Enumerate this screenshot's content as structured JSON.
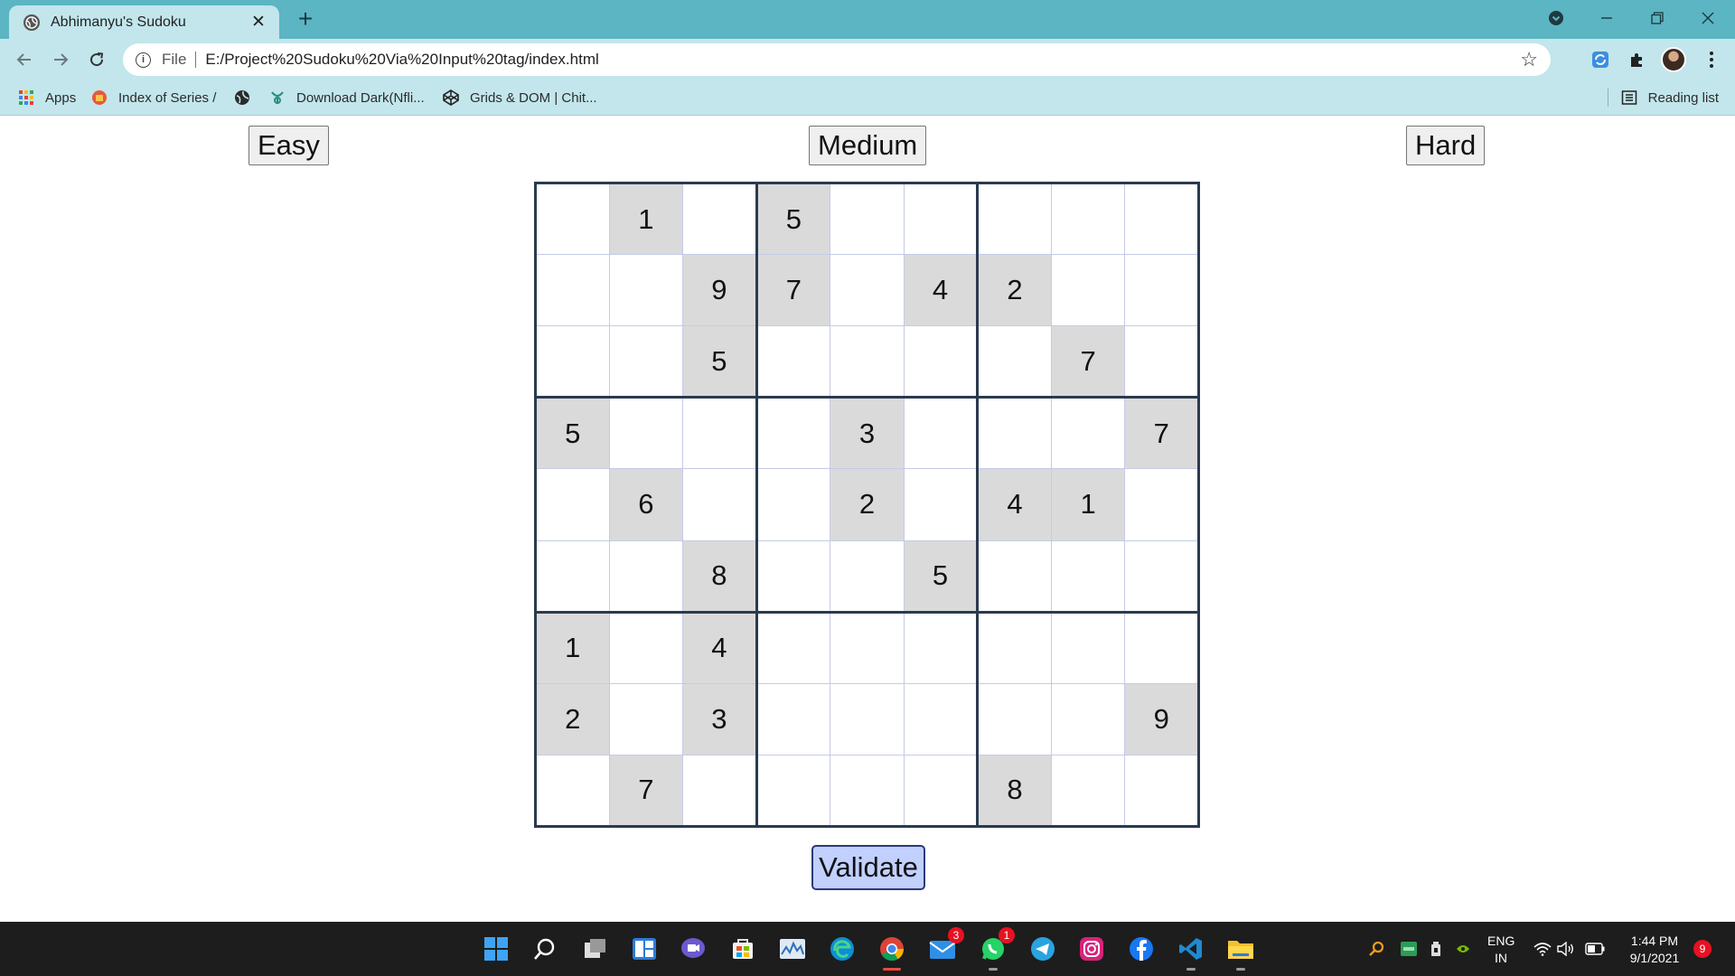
{
  "browser": {
    "tab_title": "Abhimanyu's Sudoku",
    "tab_close": "✕",
    "new_tab": "+",
    "address": {
      "scheme_label": "File",
      "url": "E:/Project%20Sudoku%20Via%20Input%20tag/index.html"
    },
    "bookmarks": [
      {
        "label": "Apps",
        "icon": "apps-grid-icon"
      },
      {
        "label": "Index of Series /",
        "icon": "index-favicon"
      },
      {
        "label": "",
        "icon": "globe-icon"
      },
      {
        "label": "Download Dark(Nfli...",
        "icon": "download-favicon"
      },
      {
        "label": "Grids & DOM | Chit...",
        "icon": "codepen-icon"
      }
    ],
    "reading_list": "Reading list"
  },
  "page": {
    "difficulty": {
      "easy": "Easy",
      "medium": "Medium",
      "hard": "Hard"
    },
    "validate_label": "Validate",
    "grid": [
      [
        "",
        "1",
        "",
        "5",
        "",
        "",
        "",
        "",
        ""
      ],
      [
        "",
        "",
        "9",
        "7",
        "",
        "4",
        "2",
        "",
        ""
      ],
      [
        "",
        "",
        "5",
        "",
        "",
        "",
        "",
        "7",
        ""
      ],
      [
        "5",
        "",
        "",
        "",
        "3",
        "",
        "",
        "",
        "7"
      ],
      [
        "",
        "6",
        "",
        "",
        "2",
        "",
        "4",
        "1",
        ""
      ],
      [
        "",
        "",
        "8",
        "",
        "",
        "5",
        "",
        "",
        ""
      ],
      [
        "1",
        "",
        "4",
        "",
        "",
        "",
        "",
        "",
        ""
      ],
      [
        "2",
        "",
        "3",
        "",
        "",
        "",
        "",
        "",
        "9"
      ],
      [
        "",
        "7",
        "",
        "",
        "",
        "",
        "8",
        "",
        ""
      ]
    ]
  },
  "taskbar": {
    "apps": [
      "start",
      "search",
      "task-view",
      "widgets",
      "teams-chat",
      "store",
      "photos",
      "edge",
      "chrome",
      "mail",
      "whatsapp",
      "telegram",
      "instagram",
      "facebook",
      "vscode",
      "file-explorer"
    ],
    "mail_badge": "3",
    "whatsapp_badge": "1",
    "language": [
      "ENG",
      "IN"
    ],
    "time": "1:44 PM",
    "date": "9/1/2021",
    "notification_count": "9"
  },
  "colors": {
    "titlebar": "#5cb5c2",
    "toolbar": "#c2e6ec",
    "given_cell": "#dadada",
    "validate_bg": "#c1d0fd",
    "taskbar": "#1d1d1d"
  }
}
